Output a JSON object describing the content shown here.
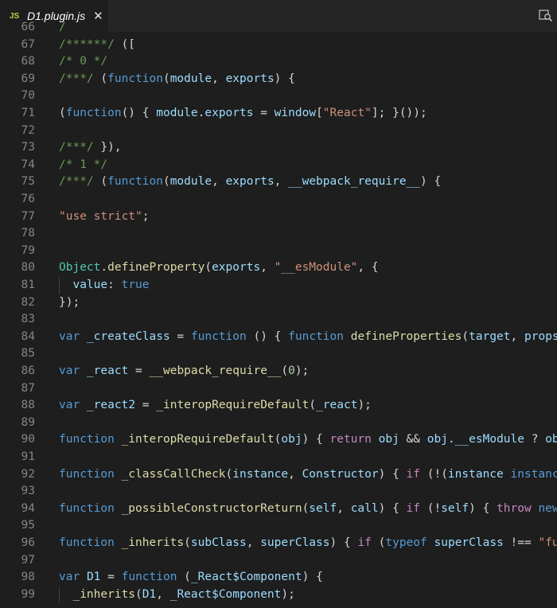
{
  "tab": {
    "icon_text": "JS",
    "filename": "D1.plugin.js",
    "close_glyph": "✕"
  },
  "toolbar": {
    "search_icon": "search-icon"
  },
  "lines": [
    {
      "n": "66",
      "tokens": [
        [
          "c",
          "/"
        ]
      ]
    },
    {
      "n": "67",
      "tokens": [
        [
          "c",
          "/******/"
        ],
        [
          "p",
          " (["
        ]
      ]
    },
    {
      "n": "68",
      "tokens": [
        [
          "c",
          "/* 0 */"
        ]
      ]
    },
    {
      "n": "69",
      "tokens": [
        [
          "c",
          "/***/"
        ],
        [
          "p",
          " ("
        ],
        [
          "k",
          "function"
        ],
        [
          "p",
          "("
        ],
        [
          "v",
          "module"
        ],
        [
          "p",
          ", "
        ],
        [
          "v",
          "exports"
        ],
        [
          "p",
          ") {"
        ]
      ]
    },
    {
      "n": "70",
      "tokens": []
    },
    {
      "n": "71",
      "tokens": [
        [
          "p",
          "("
        ],
        [
          "k",
          "function"
        ],
        [
          "p",
          "() { "
        ],
        [
          "v",
          "module"
        ],
        [
          "p",
          "."
        ],
        [
          "v",
          "exports"
        ],
        [
          "p",
          " = "
        ],
        [
          "v",
          "window"
        ],
        [
          "p",
          "["
        ],
        [
          "s",
          "\"React\""
        ],
        [
          "p",
          "]; }());"
        ]
      ]
    },
    {
      "n": "72",
      "tokens": []
    },
    {
      "n": "73",
      "tokens": [
        [
          "c",
          "/***/"
        ],
        [
          "p",
          " }),"
        ]
      ]
    },
    {
      "n": "74",
      "tokens": [
        [
          "c",
          "/* 1 */"
        ]
      ]
    },
    {
      "n": "75",
      "tokens": [
        [
          "c",
          "/***/"
        ],
        [
          "p",
          " ("
        ],
        [
          "k",
          "function"
        ],
        [
          "p",
          "("
        ],
        [
          "v",
          "module"
        ],
        [
          "p",
          ", "
        ],
        [
          "v",
          "exports"
        ],
        [
          "p",
          ", "
        ],
        [
          "v",
          "__webpack_require__"
        ],
        [
          "p",
          ") {"
        ]
      ]
    },
    {
      "n": "76",
      "tokens": []
    },
    {
      "n": "77",
      "tokens": [
        [
          "s",
          "\"use strict\""
        ],
        [
          "p",
          ";"
        ]
      ]
    },
    {
      "n": "78",
      "tokens": []
    },
    {
      "n": "79",
      "tokens": []
    },
    {
      "n": "80",
      "tokens": [
        [
          "t",
          "Object"
        ],
        [
          "p",
          "."
        ],
        [
          "f",
          "defineProperty"
        ],
        [
          "p",
          "("
        ],
        [
          "v",
          "exports"
        ],
        [
          "p",
          ", "
        ],
        [
          "s",
          "\"__esModule\""
        ],
        [
          "p",
          ", {"
        ]
      ]
    },
    {
      "n": "81",
      "tokens": [
        [
          "p",
          "  "
        ],
        [
          "v",
          "value"
        ],
        [
          "p",
          ": "
        ],
        [
          "k",
          "true"
        ]
      ]
    },
    {
      "n": "82",
      "tokens": [
        [
          "p",
          "});"
        ]
      ]
    },
    {
      "n": "83",
      "tokens": []
    },
    {
      "n": "84",
      "tokens": [
        [
          "k",
          "var"
        ],
        [
          "p",
          " "
        ],
        [
          "v",
          "_createClass"
        ],
        [
          "p",
          " = "
        ],
        [
          "k",
          "function"
        ],
        [
          "p",
          " () { "
        ],
        [
          "k",
          "function"
        ],
        [
          "p",
          " "
        ],
        [
          "f",
          "defineProperties"
        ],
        [
          "p",
          "("
        ],
        [
          "v",
          "target"
        ],
        [
          "p",
          ", "
        ],
        [
          "v",
          "props"
        ]
      ]
    },
    {
      "n": "85",
      "tokens": []
    },
    {
      "n": "86",
      "tokens": [
        [
          "k",
          "var"
        ],
        [
          "p",
          " "
        ],
        [
          "v",
          "_react"
        ],
        [
          "p",
          " = "
        ],
        [
          "f",
          "__webpack_require__"
        ],
        [
          "p",
          "("
        ],
        [
          "n",
          "0"
        ],
        [
          "p",
          ");"
        ]
      ]
    },
    {
      "n": "87",
      "tokens": []
    },
    {
      "n": "88",
      "tokens": [
        [
          "k",
          "var"
        ],
        [
          "p",
          " "
        ],
        [
          "v",
          "_react2"
        ],
        [
          "p",
          " = "
        ],
        [
          "f",
          "_interopRequireDefault"
        ],
        [
          "p",
          "("
        ],
        [
          "v",
          "_react"
        ],
        [
          "p",
          ");"
        ]
      ]
    },
    {
      "n": "89",
      "tokens": []
    },
    {
      "n": "90",
      "tokens": [
        [
          "k",
          "function"
        ],
        [
          "p",
          " "
        ],
        [
          "f",
          "_interopRequireDefault"
        ],
        [
          "p",
          "("
        ],
        [
          "v",
          "obj"
        ],
        [
          "p",
          ") { "
        ],
        [
          "ck",
          "return"
        ],
        [
          "p",
          " "
        ],
        [
          "v",
          "obj"
        ],
        [
          "p",
          " && "
        ],
        [
          "v",
          "obj"
        ],
        [
          "p",
          "."
        ],
        [
          "v",
          "__esModule"
        ],
        [
          "p",
          " ? "
        ],
        [
          "v",
          "ob"
        ]
      ]
    },
    {
      "n": "91",
      "tokens": []
    },
    {
      "n": "92",
      "tokens": [
        [
          "k",
          "function"
        ],
        [
          "p",
          " "
        ],
        [
          "f",
          "_classCallCheck"
        ],
        [
          "p",
          "("
        ],
        [
          "v",
          "instance"
        ],
        [
          "p",
          ", "
        ],
        [
          "v",
          "Constructor"
        ],
        [
          "p",
          ") { "
        ],
        [
          "ck",
          "if"
        ],
        [
          "p",
          " (!("
        ],
        [
          "v",
          "instance"
        ],
        [
          "p",
          " "
        ],
        [
          "k",
          "instanc"
        ]
      ]
    },
    {
      "n": "93",
      "tokens": []
    },
    {
      "n": "94",
      "tokens": [
        [
          "k",
          "function"
        ],
        [
          "p",
          " "
        ],
        [
          "f",
          "_possibleConstructorReturn"
        ],
        [
          "p",
          "("
        ],
        [
          "v",
          "self"
        ],
        [
          "p",
          ", "
        ],
        [
          "v",
          "call"
        ],
        [
          "p",
          ") { "
        ],
        [
          "ck",
          "if"
        ],
        [
          "p",
          " (!"
        ],
        [
          "v",
          "self"
        ],
        [
          "p",
          ") { "
        ],
        [
          "ck",
          "throw"
        ],
        [
          "p",
          " "
        ],
        [
          "k",
          "new"
        ]
      ]
    },
    {
      "n": "95",
      "tokens": []
    },
    {
      "n": "96",
      "tokens": [
        [
          "k",
          "function"
        ],
        [
          "p",
          " "
        ],
        [
          "f",
          "_inherits"
        ],
        [
          "p",
          "("
        ],
        [
          "v",
          "subClass"
        ],
        [
          "p",
          ", "
        ],
        [
          "v",
          "superClass"
        ],
        [
          "p",
          ") { "
        ],
        [
          "ck",
          "if"
        ],
        [
          "p",
          " ("
        ],
        [
          "k",
          "typeof"
        ],
        [
          "p",
          " "
        ],
        [
          "v",
          "superClass"
        ],
        [
          "p",
          " !== "
        ],
        [
          "s",
          "\"fu"
        ]
      ]
    },
    {
      "n": "97",
      "tokens": []
    },
    {
      "n": "98",
      "tokens": [
        [
          "k",
          "var"
        ],
        [
          "p",
          " "
        ],
        [
          "v",
          "D1"
        ],
        [
          "p",
          " = "
        ],
        [
          "k",
          "function"
        ],
        [
          "p",
          " ("
        ],
        [
          "v",
          "_React$Component"
        ],
        [
          "p",
          ") {"
        ]
      ]
    },
    {
      "n": "99",
      "tokens": [
        [
          "p",
          "  "
        ],
        [
          "f",
          "_inherits"
        ],
        [
          "p",
          "("
        ],
        [
          "v",
          "D1"
        ],
        [
          "p",
          ", "
        ],
        [
          "v",
          "_React$Component"
        ],
        [
          "p",
          ");"
        ]
      ]
    }
  ]
}
